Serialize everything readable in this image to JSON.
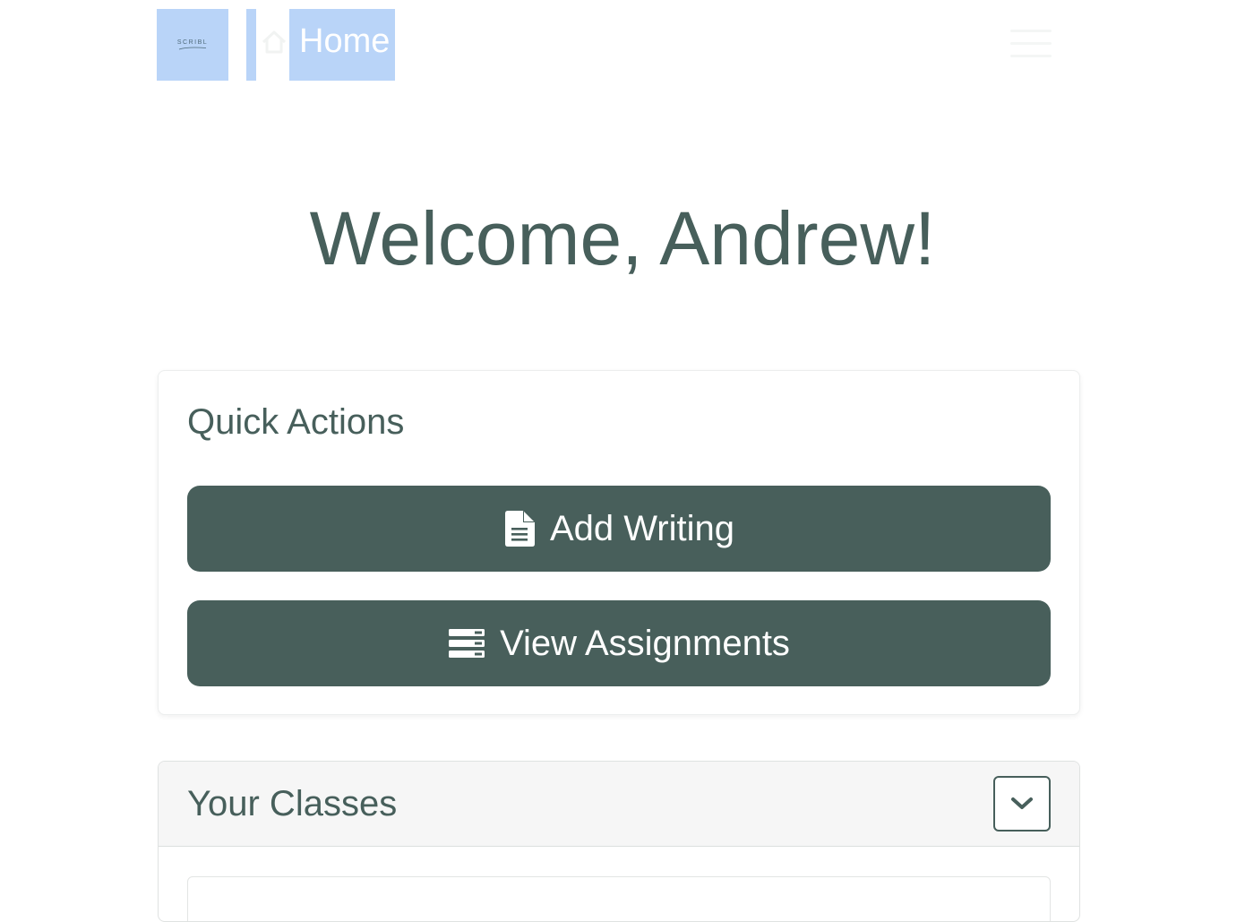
{
  "navbar": {
    "logo_text": "SCRIBL",
    "home_label": "Home"
  },
  "welcome": {
    "heading": "Welcome, Andrew!"
  },
  "quick_actions": {
    "title": "Quick Actions",
    "add_writing_label": "Add Writing",
    "view_assignments_label": "View Assignments"
  },
  "classes": {
    "title": "Your Classes"
  },
  "icons": {
    "home": "home-icon",
    "menu": "hamburger-menu-icon",
    "add_writing": "file-text-icon",
    "view_assignments": "list-icon",
    "collapse": "chevron-down-icon"
  },
  "colors": {
    "primary": "#485f5b",
    "highlight": "#b9d4f8",
    "header_bg": "#f6f6f6"
  }
}
